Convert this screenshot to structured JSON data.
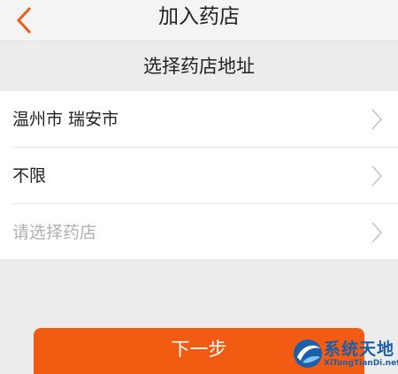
{
  "nav": {
    "title": "加入药店",
    "back_icon": "chevron-left-icon"
  },
  "section": {
    "title": "选择药店地址"
  },
  "rows": [
    {
      "label": "温州市 瑞安市",
      "placeholder": false,
      "icon": "chevron-right-icon"
    },
    {
      "label": "不限",
      "placeholder": false,
      "icon": "chevron-right-icon"
    },
    {
      "label": "请选择药店",
      "placeholder": true,
      "icon": "chevron-right-icon"
    }
  ],
  "next_button": {
    "label": "下一步"
  },
  "watermark": {
    "title": "系统天地",
    "url": "XiTongTianDi.net"
  },
  "colors": {
    "accent": "#f25c12",
    "back_arrow": "#f25c12",
    "background": "#ececec"
  }
}
